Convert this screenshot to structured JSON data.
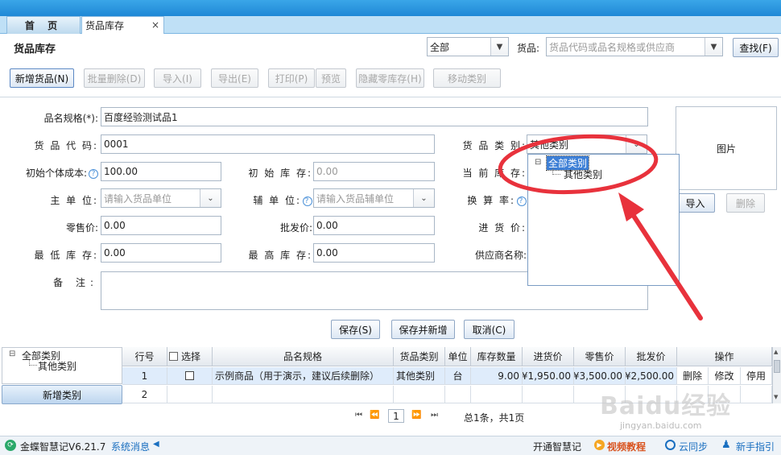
{
  "tabs": {
    "home": "首 页",
    "inventory": "货品库存",
    "close": "×"
  },
  "header": {
    "page_title": "货品库存",
    "category_filter": "全部",
    "goods_label": "货品:",
    "search_placeholder": "货品代码或品名规格或供应商",
    "search_button": "查找(F)"
  },
  "toolbar": {
    "add": "新增货品(N)",
    "batch_delete": "批量删除(D)",
    "import": "导入(I)",
    "export": "导出(E)",
    "print": "打印(P)",
    "preview": "预览",
    "hide_zero": "隐藏零库存(H)",
    "move_category": "移动类别"
  },
  "form": {
    "name_label": "品名规格(*):",
    "name_value": "百度经验测试品1",
    "code_label": "货 品 代 码:",
    "code_value": "0001",
    "category_label": "货 品 类 别:",
    "category_value": "其他类别",
    "unit_cost_label": "初始个体成本:",
    "unit_cost_value": "100.00",
    "init_stock_label": "初 始 库 存:",
    "init_stock_value": "0.00",
    "current_stock_label": "当 前 库 存:",
    "main_unit_label": "主 单 位:",
    "main_unit_placeholder": "请输入货品单位",
    "aux_unit_label": "辅 单 位:",
    "aux_unit_placeholder": "请输入货品辅单位",
    "conversion_label": "换 算 率:",
    "retail_label": "零售价:",
    "retail_value": "0.00",
    "wholesale_label": "批发价:",
    "wholesale_value": "0.00",
    "purchase_label": "进 货 价:",
    "min_stock_label": "最 低 库 存:",
    "min_stock_value": "0.00",
    "max_stock_label": "最 高 库 存:",
    "max_stock_value": "0.00",
    "supplier_label": "供应商名称:",
    "remark_label": "备 注:",
    "image_label": "图片",
    "image_import": "导入",
    "image_delete": "删除",
    "save": "保存(S)",
    "save_new": "保存并新增",
    "cancel": "取消(C)"
  },
  "dropdown_tree": {
    "root": "全部类别",
    "child": "其他类别"
  },
  "side_tree": {
    "root": "全部类别",
    "child": "其他类别",
    "add_button": "新增类别"
  },
  "table": {
    "headers": [
      "行号",
      "选择",
      "品名规格",
      "货品类别",
      "单位",
      "库存数量",
      "进货价",
      "零售价",
      "批发价",
      "操作"
    ],
    "rows": [
      {
        "no": "1",
        "name": "示例商品（用于演示，建议后续删除）",
        "category": "其他类别",
        "unit": "台",
        "qty": "9.00",
        "purchase": "¥1,950.00",
        "retail": "¥3,500.00",
        "wholesale": "¥2,500.00",
        "delete": "删除",
        "edit": "修改",
        "disable": "停用"
      },
      {
        "no": "2"
      }
    ]
  },
  "pager": {
    "page": "1",
    "summary": "总1条，共1页"
  },
  "status": {
    "app": "金蝶智慧记V6.21.7",
    "messages": "系统消息",
    "open": "开通智慧记",
    "video": "视频教程",
    "sync": "云同步",
    "guide": "新手指引"
  },
  "watermark": {
    "brand": "Baidu经验",
    "url": "jingyan.baidu.com"
  },
  "colors": {
    "accent": "#1f88d6",
    "annotation": "#e8323c"
  }
}
